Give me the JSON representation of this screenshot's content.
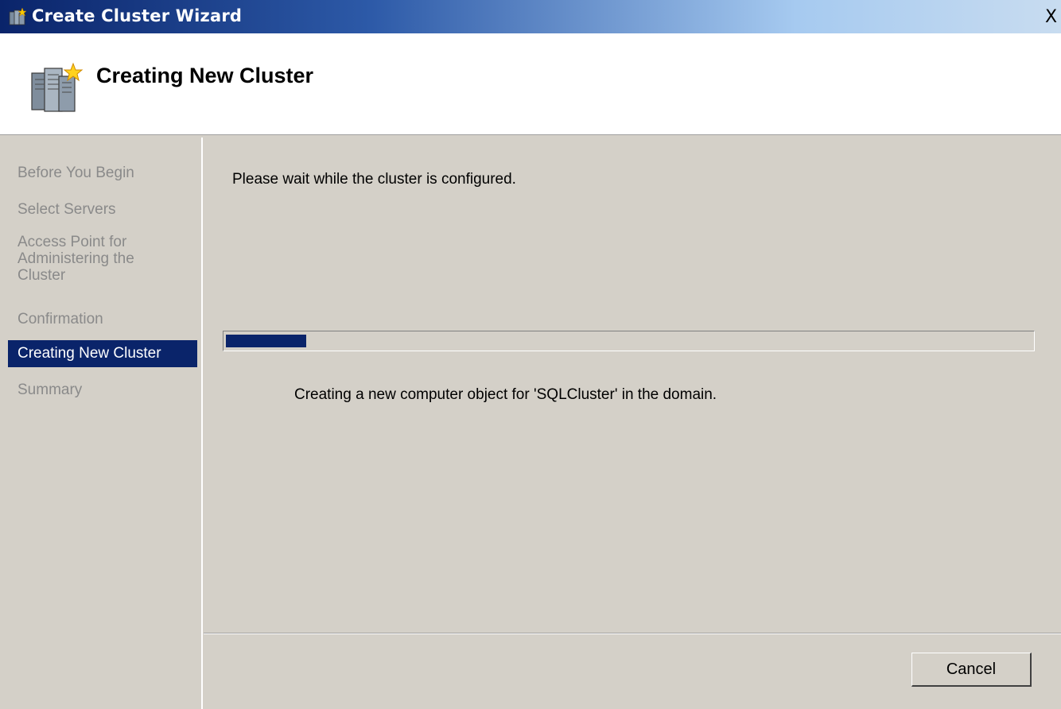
{
  "window": {
    "title": "Create Cluster Wizard",
    "close_glyph": "X",
    "icon": "cluster-wizard-icon"
  },
  "header": {
    "title": "Creating New Cluster",
    "icon": "cluster-servers-icon"
  },
  "sidebar": {
    "steps": [
      {
        "label": "Before You Begin",
        "state": "disabled"
      },
      {
        "label": "Select Servers",
        "state": "disabled"
      },
      {
        "label": "Access Point for Administering the Cluster",
        "state": "disabled"
      },
      {
        "label": "Confirmation",
        "state": "disabled"
      },
      {
        "label": "Creating New Cluster",
        "state": "active"
      },
      {
        "label": "Summary",
        "state": "disabled"
      }
    ]
  },
  "main": {
    "wait_text": "Please wait while the cluster is configured.",
    "progress_fraction": 0.1,
    "status_text": "Creating a new computer object for 'SQLCluster' in the domain."
  },
  "footer": {
    "cancel_label": "Cancel"
  },
  "colors": {
    "selection": "#0a246a",
    "dialog_bg": "#d4d0c8",
    "disabled_text": "#8a8a8a"
  }
}
